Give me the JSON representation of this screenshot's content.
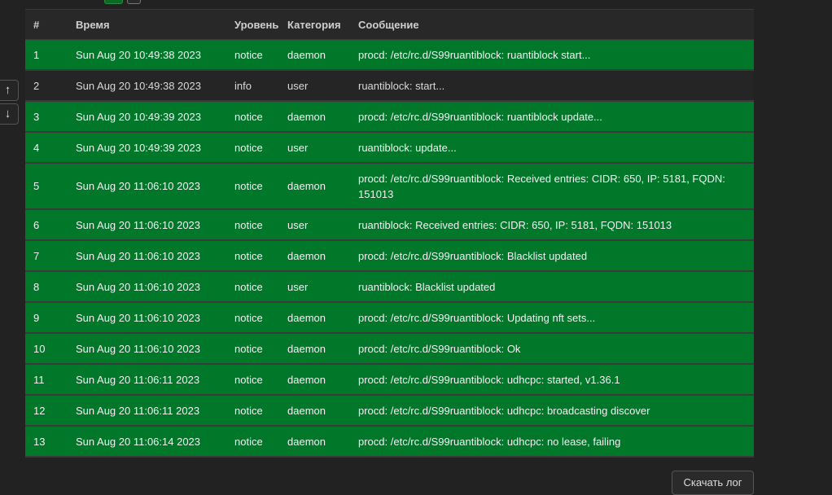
{
  "toolbar": {
    "top_buttons": [
      "",
      ""
    ]
  },
  "side_nav": {
    "up_icon": "↑",
    "down_icon": "↓"
  },
  "table": {
    "headers": [
      "#",
      "Время",
      "Уровень",
      "Категория",
      "Сообщение"
    ],
    "rows": [
      {
        "n": "1",
        "time": "Sun Aug 20 10:49:38 2023",
        "level": "notice",
        "cat": "daemon",
        "msg": "procd: /etc/rc.d/S99ruantiblock: ruantiblock start..."
      },
      {
        "n": "2",
        "time": "Sun Aug 20 10:49:38 2023",
        "level": "info",
        "cat": "user",
        "msg": "ruantiblock: start..."
      },
      {
        "n": "3",
        "time": "Sun Aug 20 10:49:39 2023",
        "level": "notice",
        "cat": "daemon",
        "msg": "procd: /etc/rc.d/S99ruantiblock: ruantiblock update..."
      },
      {
        "n": "4",
        "time": "Sun Aug 20 10:49:39 2023",
        "level": "notice",
        "cat": "user",
        "msg": "ruantiblock: update..."
      },
      {
        "n": "5",
        "time": "Sun Aug 20 11:06:10 2023",
        "level": "notice",
        "cat": "daemon",
        "msg": "procd: /etc/rc.d/S99ruantiblock: Received entries: CIDR: 650, IP: 5181, FQDN: 151013"
      },
      {
        "n": "6",
        "time": "Sun Aug 20 11:06:10 2023",
        "level": "notice",
        "cat": "user",
        "msg": "ruantiblock: Received entries: CIDR: 650, IP: 5181, FQDN: 151013"
      },
      {
        "n": "7",
        "time": "Sun Aug 20 11:06:10 2023",
        "level": "notice",
        "cat": "daemon",
        "msg": "procd: /etc/rc.d/S99ruantiblock: Blacklist updated"
      },
      {
        "n": "8",
        "time": "Sun Aug 20 11:06:10 2023",
        "level": "notice",
        "cat": "user",
        "msg": "ruantiblock: Blacklist updated"
      },
      {
        "n": "9",
        "time": "Sun Aug 20 11:06:10 2023",
        "level": "notice",
        "cat": "daemon",
        "msg": "procd: /etc/rc.d/S99ruantiblock: Updating nft sets..."
      },
      {
        "n": "10",
        "time": "Sun Aug 20 11:06:10 2023",
        "level": "notice",
        "cat": "daemon",
        "msg": "procd: /etc/rc.d/S99ruantiblock: Ok"
      },
      {
        "n": "11",
        "time": "Sun Aug 20 11:06:11 2023",
        "level": "notice",
        "cat": "daemon",
        "msg": "procd: /etc/rc.d/S99ruantiblock: udhcpc: started, v1.36.1"
      },
      {
        "n": "12",
        "time": "Sun Aug 20 11:06:11 2023",
        "level": "notice",
        "cat": "daemon",
        "msg": "procd: /etc/rc.d/S99ruantiblock: udhcpc: broadcasting discover"
      },
      {
        "n": "13",
        "time": "Sun Aug 20 11:06:14 2023",
        "level": "notice",
        "cat": "daemon",
        "msg": "procd: /etc/rc.d/S99ruantiblock: udhcpc: no lease, failing"
      }
    ]
  },
  "colors": {
    "notice": "#007729",
    "info": "#252525"
  },
  "download_label": "Скачать лог"
}
